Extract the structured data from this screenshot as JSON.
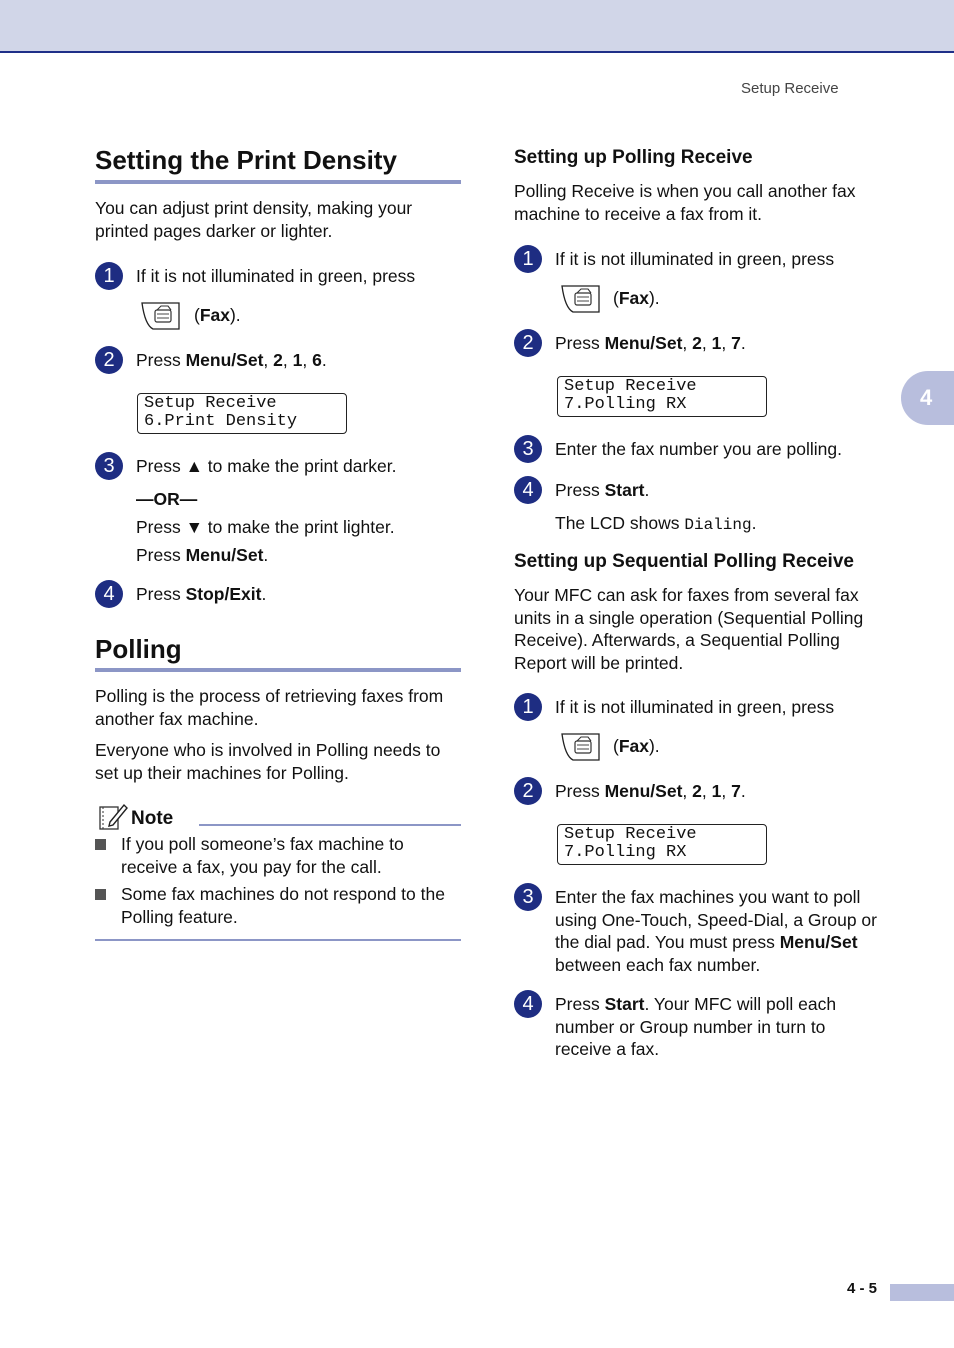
{
  "header": {
    "running_head": "Setup Receive",
    "chapter_tab": "4"
  },
  "left": {
    "title": "Setting the Print Density",
    "intro": "You can adjust print density, making your printed pages darker or lighter.",
    "steps": [
      {
        "num": "1",
        "text": "If it is not illuminated in green, press",
        "button_label": "Fax"
      },
      {
        "num": "2",
        "prefix": "Press ",
        "bold": "Menu/Set",
        "suffix_parts": [
          "2",
          "1",
          "6"
        ]
      },
      {
        "num": "3",
        "line1_a": "Press ",
        "line1_b": " to make the print darker.",
        "or": "—OR—",
        "line2_a": "Press ",
        "line2_b": " to make the print lighter.",
        "line3_a": "Press ",
        "line3_bold": "Menu/Set",
        "up_arrow": "▲",
        "down_arrow": "▼"
      },
      {
        "num": "4",
        "prefix": "Press ",
        "bold": "Stop/Exit"
      }
    ],
    "lcd": {
      "line1": "Setup Receive",
      "line2": "6.Print Density"
    },
    "polling": {
      "title": "Polling",
      "p1": "Polling is the process of retrieving faxes from another fax machine.",
      "p2": "Everyone who is involved in Polling needs to set up their machines for Polling."
    },
    "note": {
      "title": "Note",
      "items": [
        "If you poll someone’s fax machine to receive a fax, you pay for the call.",
        "Some fax machines do not respond to the Polling feature."
      ]
    }
  },
  "right": {
    "polling_receive": {
      "title": "Setting up Polling Receive",
      "intro": "Polling Receive is when you call another fax machine to receive a fax from it.",
      "step1": {
        "num": "1",
        "text": "If it is not illuminated in green, press",
        "button_label": "Fax"
      },
      "step2": {
        "num": "2",
        "prefix": "Press ",
        "bold": "Menu/Set",
        "suffix_parts": [
          "2",
          "1",
          "7"
        ]
      },
      "lcd": {
        "line1": "Setup Receive",
        "line2": "7.Polling RX"
      },
      "step3": {
        "num": "3",
        "text": "Enter the fax number you are polling."
      },
      "step4": {
        "num": "4",
        "prefix": "Press ",
        "bold": "Start",
        "lcd_line_a": "The LCD shows ",
        "lcd_value": "Dialing"
      }
    },
    "sequential": {
      "title": "Setting up Sequential Polling Receive",
      "intro": "Your MFC can ask for faxes from several fax units in a single operation (Sequential Polling Receive). Afterwards, a Sequential Polling Report will be printed.",
      "step1": {
        "num": "1",
        "text": "If it is not illuminated in green, press",
        "button_label": "Fax"
      },
      "step2": {
        "num": "2",
        "prefix": "Press ",
        "bold": "Menu/Set",
        "suffix_parts": [
          "2",
          "1",
          "7"
        ]
      },
      "lcd": {
        "line1": "Setup Receive",
        "line2": "7.Polling RX"
      },
      "step3": {
        "num": "3",
        "text": "Enter the fax machines you want to poll using One-Touch, Speed-Dial, a Group or the dial pad. You must press ",
        "bold": "Menu/Set",
        "suffix": " between each fax number."
      },
      "step4": {
        "num": "4",
        "prefix": "Press ",
        "bold": "Start",
        "suffix": ". Your MFC will poll each number or Group number in turn to receive a fax."
      }
    }
  },
  "footer": {
    "page_number": "4 - 5"
  }
}
